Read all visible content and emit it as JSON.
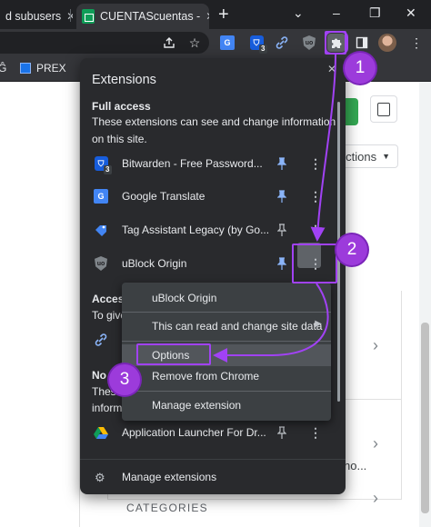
{
  "browser": {
    "tabs": [
      {
        "title": "d subusers",
        "close": "✕"
      },
      {
        "title": "CUENTAScuentas -",
        "close": "✕"
      }
    ],
    "new_tab": "+",
    "window_controls": {
      "minimize": "–",
      "restore": "❐",
      "close": "✕",
      "tab_search": "⌄"
    },
    "toolbar": {
      "share_icon": "share-icon",
      "star_icon": "star-icon",
      "extensions": [
        {
          "name": "Google Translate",
          "icon": "google-translate-icon"
        },
        {
          "name": "Bitwarden",
          "icon": "bitwarden-icon",
          "badge": "3"
        },
        {
          "name": "Link",
          "icon": "link-icon"
        },
        {
          "name": "uBlock Origin",
          "icon": "ublock-origin-icon"
        }
      ],
      "menu": "⋮"
    },
    "bookmarks": [
      {
        "label": "PREX"
      }
    ]
  },
  "page": {
    "actions_label": "ctions",
    "snippet": "no...",
    "categories_label": "CATEGORIES"
  },
  "extensions_popup": {
    "title": "Extensions",
    "close": "✕",
    "full_access": {
      "heading": "Full access",
      "description_line1": "These extensions can see and change information",
      "description_line2": "on this site."
    },
    "items": [
      {
        "name": "Bitwarden - Free Password...",
        "pinned": true
      },
      {
        "name": "Google Translate",
        "pinned": true
      },
      {
        "name": "Tag Assistant Legacy (by Go...",
        "pinned": false
      },
      {
        "name": "uBlock Origin",
        "pinned": true
      }
    ],
    "access_partial": {
      "heading": "Access",
      "description": "To give"
    },
    "no_access": {
      "heading": "No a",
      "description_line1": "These",
      "description_line2": "inform"
    },
    "extra_item": {
      "name": "Application Launcher For Dr...",
      "pinned": false
    },
    "manage_label": "Manage extensions",
    "more_glyph": "⋮"
  },
  "context_menu": {
    "items": [
      {
        "label": "uBlock Origin"
      },
      {
        "label": "This can read and change site data",
        "submenu": "▶"
      },
      {
        "label": "Options"
      },
      {
        "label": "Remove from Chrome"
      },
      {
        "label": "Manage extension"
      }
    ]
  },
  "annotations": {
    "steps": [
      "1",
      "2",
      "3"
    ],
    "color": "#a142f4"
  }
}
